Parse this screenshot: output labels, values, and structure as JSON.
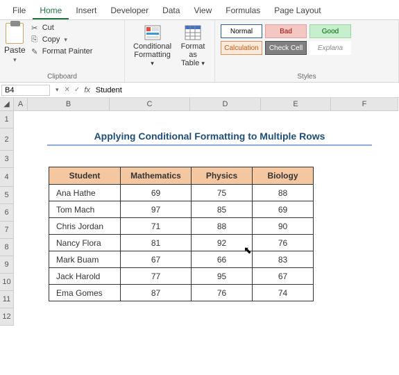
{
  "ribbon": {
    "tabs": [
      "File",
      "Home",
      "Insert",
      "Developer",
      "Data",
      "View",
      "Formulas",
      "Page Layout"
    ],
    "active_tab": "Home",
    "clipboard": {
      "paste": "Paste",
      "cut": "Cut",
      "copy": "Copy",
      "format_painter": "Format Painter",
      "group_label": "Clipboard"
    },
    "cond_format": "Conditional\nFormatting",
    "format_table": "Format as\nTable",
    "styles": {
      "normal": "Normal",
      "bad": "Bad",
      "good": "Good",
      "calculation": "Calculation",
      "check_cell": "Check Cell",
      "explanatory": "Explana",
      "group_label": "Styles"
    }
  },
  "namebox": {
    "cell_ref": "B4",
    "fx": "fx",
    "formula_value": "Student"
  },
  "columns": [
    "A",
    "B",
    "C",
    "D",
    "E",
    "F"
  ],
  "rows": [
    "1",
    "2",
    "3",
    "4",
    "5",
    "6",
    "7",
    "8",
    "9",
    "10",
    "11",
    "12"
  ],
  "sheet": {
    "title": "Applying Conditional Formatting to Multiple Rows",
    "headers": [
      "Student",
      "Mathematics",
      "Physics",
      "Biology"
    ],
    "data": [
      [
        "Ana Hathe",
        "69",
        "75",
        "88"
      ],
      [
        "Tom Mach",
        "97",
        "85",
        "69"
      ],
      [
        "Chris Jordan",
        "71",
        "88",
        "90"
      ],
      [
        "Nancy Flora",
        "81",
        "92",
        "76"
      ],
      [
        "Mark Buam",
        "67",
        "66",
        "83"
      ],
      [
        "Jack Harold",
        "77",
        "95",
        "67"
      ],
      [
        "Ema Gomes",
        "87",
        "76",
        "74"
      ]
    ]
  }
}
